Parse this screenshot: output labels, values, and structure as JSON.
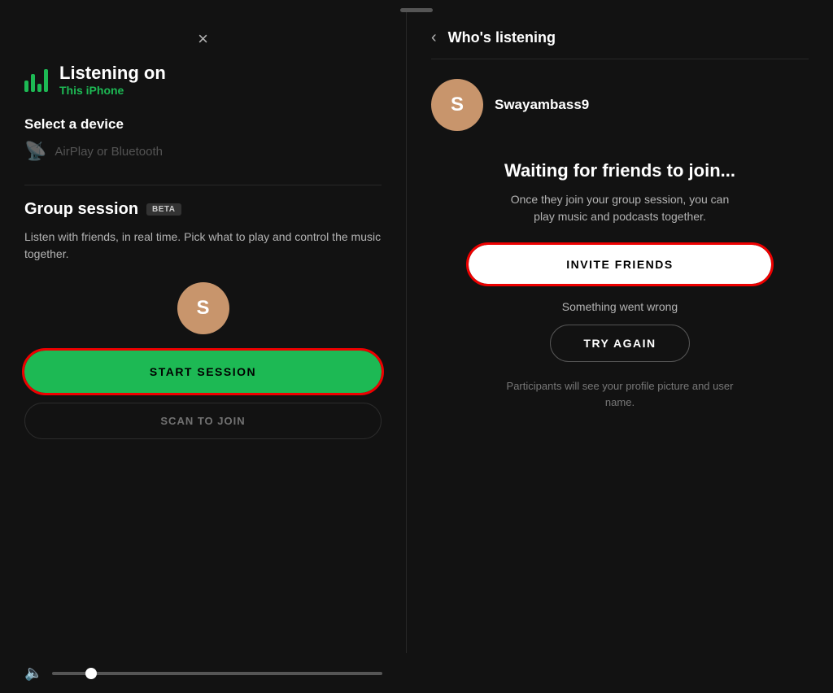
{
  "drag_handle": true,
  "left": {
    "close_label": "×",
    "listening_on_label": "Listening on",
    "device_label": "This iPhone",
    "select_device_label": "Select a device",
    "airplay_label": "AirPlay or Bluetooth",
    "group_session_title": "Group session",
    "beta_label": "BETA",
    "group_session_desc": "Listen with friends, in real time. Pick what to play and control the music together.",
    "avatar_letter": "S",
    "start_session_label": "START SESSION",
    "scan_to_join_label": "SCAN TO JOIN"
  },
  "bottom_bar": {
    "volume_icon": "🔈"
  },
  "right": {
    "back_label": "‹",
    "title": "Who's listening",
    "listener_avatar_letter": "S",
    "listener_name": "Swayambass9",
    "waiting_title": "Waiting for friends to join...",
    "waiting_desc": "Once they join your group session, you can play music and podcasts together.",
    "invite_friends_label": "INVITE FRIENDS",
    "error_text": "Something went wrong",
    "try_again_label": "TRY AGAIN",
    "participants_note": "Participants will see your profile picture and user name."
  }
}
